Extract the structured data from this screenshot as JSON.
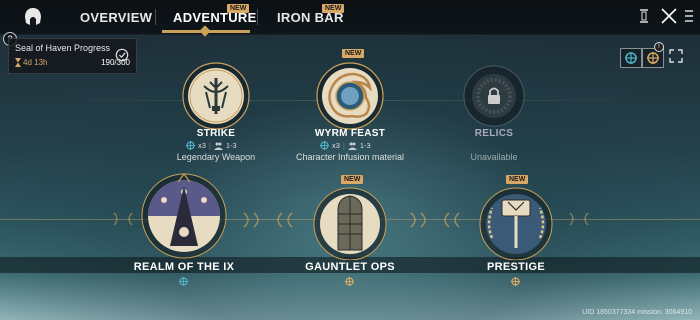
{
  "tabs": [
    {
      "label": "OVERVIEW",
      "badge": ""
    },
    {
      "label": "ADVENTURE",
      "badge": "NEW"
    },
    {
      "label": "IRON BAR",
      "badge": "NEW"
    }
  ],
  "active_tab": "ADVENTURE",
  "seal": {
    "title": "Seal of Haven Progress",
    "time": "4d 13h",
    "progress": "190/300"
  },
  "help_glyph": "?",
  "notification_count": "!",
  "nodes": {
    "strike": {
      "label": "STRIKE",
      "multiplier": "x3",
      "range": "1-3",
      "sub": "Legendary Weapon"
    },
    "wyrm": {
      "label": "WYRM FEAST",
      "badge": "NEW",
      "multiplier": "x3",
      "range": "1-3",
      "sub": "Character Infusion material"
    },
    "relics": {
      "label": "RELICS",
      "sub": "Unavailable"
    },
    "realm": {
      "label": "REALM OF THE IX"
    },
    "gauntlet": {
      "label": "GAUNTLET OPS",
      "badge": "NEW"
    },
    "prestige": {
      "label": "PRESTIGE",
      "badge": "NEW"
    }
  },
  "uid_text": "UID 1850377334  mission: 3064910",
  "colors": {
    "accent": "#c9a25a",
    "badge": "#d8a864",
    "teal": "#4fb3c4"
  }
}
